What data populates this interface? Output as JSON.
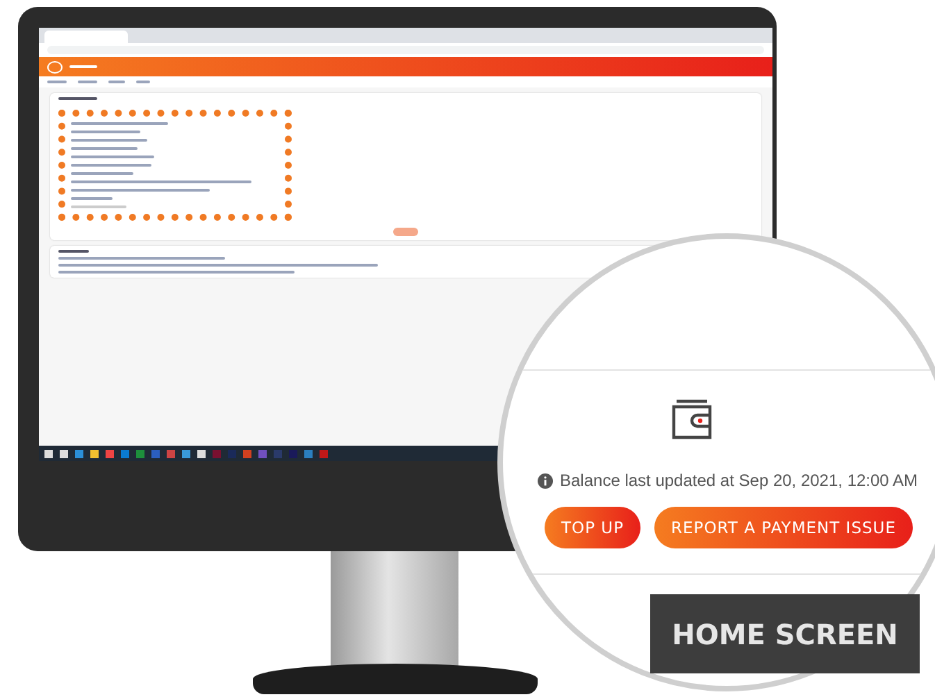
{
  "magnifier": {
    "info": "Balance last updated at Sep 20, 2021, 12:00 AM",
    "buttons": [
      "TOP UP",
      "REPORT A PAYMENT ISSUE"
    ]
  },
  "caption": "HOME SCREEN"
}
